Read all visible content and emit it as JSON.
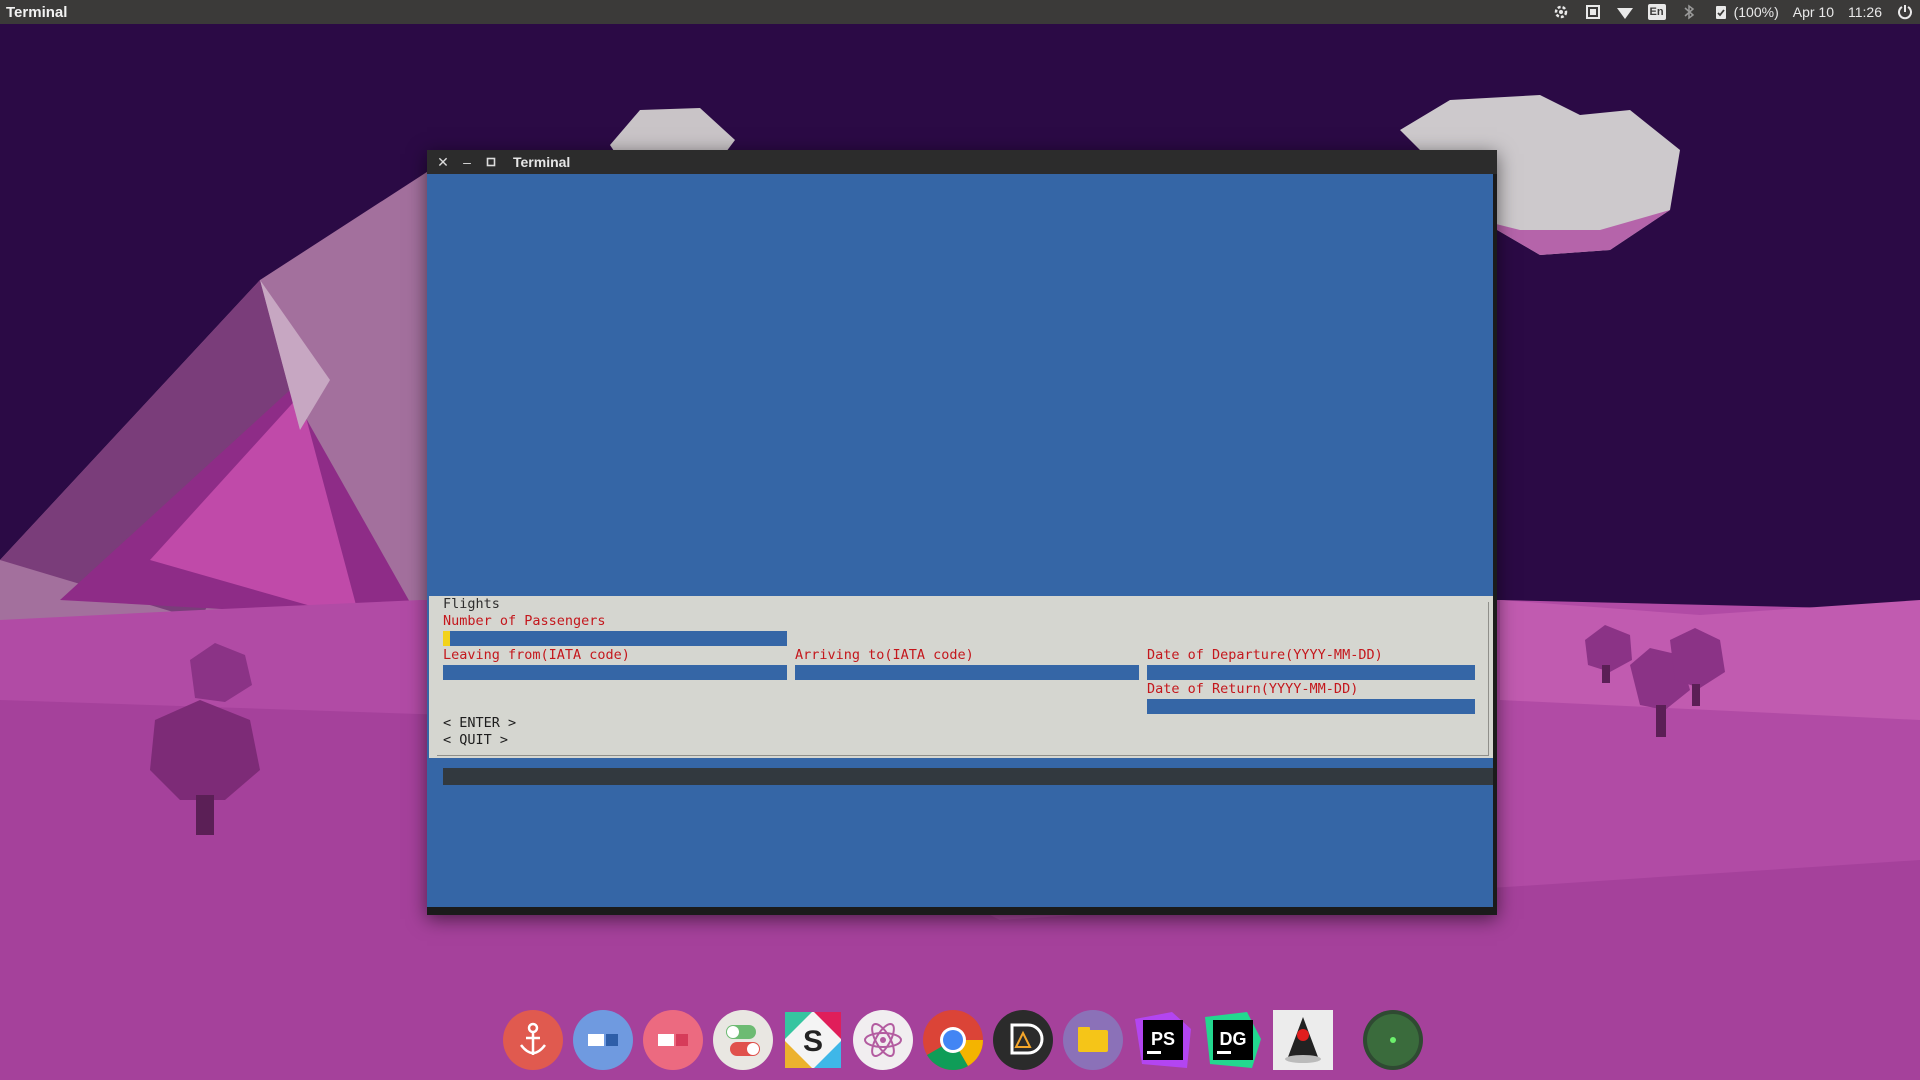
{
  "top_panel": {
    "app_title": "Terminal",
    "keyboard_layout": "En",
    "battery": "(100%)",
    "date": "Apr 10",
    "time": "11:26",
    "icons": [
      "settings-icon",
      "cpu-icon",
      "wifi-icon",
      "keyboard-layout-icon",
      "bluetooth-icon",
      "clipboard-icon",
      "power-icon"
    ]
  },
  "window": {
    "title": "Terminal",
    "buttons": [
      "close",
      "minimize",
      "maximize"
    ]
  },
  "dialog": {
    "title": "Flights",
    "passengers_label": "Number of Passengers",
    "passengers_value": "",
    "leaving_label": "Leaving from(IATA code)",
    "leaving_value": "",
    "arriving_label": "Arriving to(IATA code)",
    "arriving_value": "",
    "departure_label": "Date of Departure(YYYY-MM-DD)",
    "departure_value": "",
    "return_label": "Date of Return(YYYY-MM-DD)",
    "return_value": "",
    "enter_button": "< ENTER >",
    "quit_button": "< QUIT >"
  },
  "dock": {
    "items": [
      "anchor-icon",
      "dock-settings-icon",
      "tweaks-icon",
      "toggles-icon",
      "slack-icon",
      "atom-icon",
      "chrome-icon",
      "darktable-icon",
      "files-icon",
      "phpstorm-icon",
      "datagrip-icon",
      "java-icon",
      "trash-icon"
    ]
  },
  "colors": {
    "terminal_bg": "#3566a6",
    "dialog_bg": "#d5d6d0",
    "label_red": "#c4171c",
    "cursor_yellow": "#f2d21b",
    "panel_bg": "#3b3a39"
  }
}
